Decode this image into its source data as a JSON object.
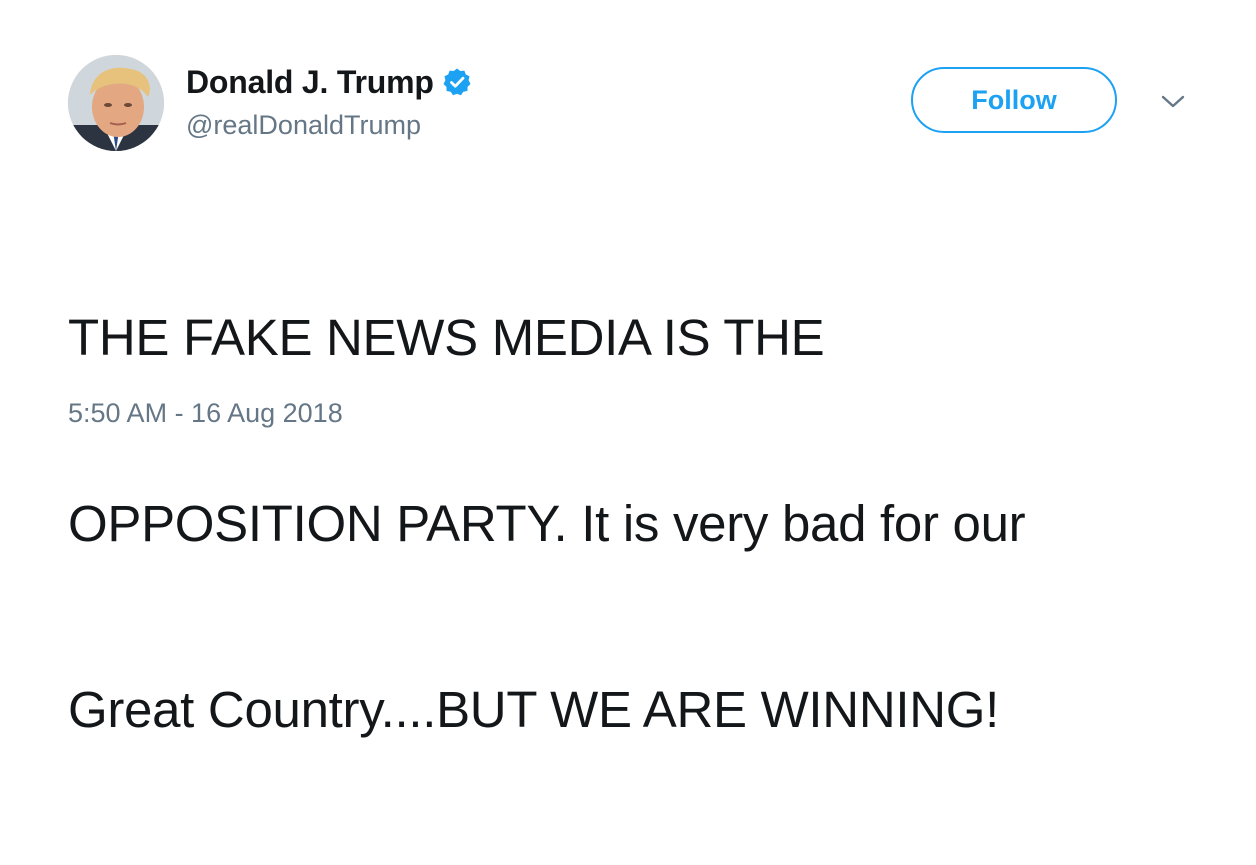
{
  "tweet": {
    "author": {
      "display_name": "Donald J. Trump",
      "handle": "@realDonaldTrump",
      "verified": true,
      "avatar_icon": "profile-photo"
    },
    "follow_label": "Follow",
    "menu_icon": "chevron-down-icon",
    "text_lines": [
      "THE FAKE NEWS MEDIA IS THE",
      "OPPOSITION PARTY. It is very bad for our",
      "Great Country....BUT WE ARE WINNING!"
    ],
    "timestamp": "5:50 AM - 16 Aug 2018"
  },
  "colors": {
    "accent": "#1da1f2",
    "text_primary": "#14171a",
    "text_secondary": "#657786",
    "background": "#ffffff"
  }
}
